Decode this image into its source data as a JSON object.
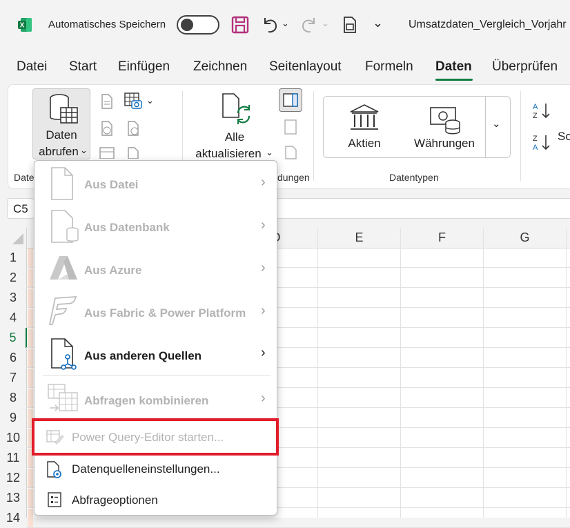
{
  "titlebar": {
    "autosave_label": "Automatisches Speichern",
    "document_title": "Umsatzdaten_Vergleich_Vorjahr"
  },
  "tabs": [
    "Datei",
    "Start",
    "Einfügen",
    "Zeichnen",
    "Seitenlayout",
    "Formeln",
    "Daten",
    "Überprüfen"
  ],
  "active_tab": "Daten",
  "ribbon": {
    "get_data_line1": "Daten",
    "get_data_line2": "abrufen",
    "group1_label": "Date",
    "refresh_line1": "Alle",
    "refresh_line2": "aktualisieren",
    "group2_label": "dungen",
    "datatype_stocks": "Aktien",
    "datatype_currencies": "Währungen",
    "datatypes_group_label": "Datentypen",
    "sort_label": "So"
  },
  "namebox": "C5",
  "columns": [
    "D",
    "E",
    "F",
    "G"
  ],
  "rows": [
    "1",
    "2",
    "3",
    "4",
    "5",
    "6",
    "7",
    "8",
    "9",
    "10",
    "11",
    "12",
    "13",
    "14"
  ],
  "active_row": "5",
  "menu": {
    "items": [
      {
        "label": "Aus Datei",
        "enabled": false
      },
      {
        "label": "Aus Datenbank",
        "enabled": false
      },
      {
        "label": "Aus Azure",
        "enabled": false
      },
      {
        "label": "Aus Fabric & Power Platform",
        "enabled": false
      },
      {
        "label": "Aus anderen Quellen",
        "enabled": true
      },
      {
        "label": "Abfragen kombinieren",
        "enabled": false
      }
    ],
    "power_query": "Power Query-Editor starten...",
    "source_settings": "Datenquelleneinstellungen...",
    "query_options": "Abfrageoptionen"
  },
  "colors": {
    "accent": "#107c41",
    "highlight": "#e21c2a",
    "disabled_text": "#b3b3b3"
  }
}
